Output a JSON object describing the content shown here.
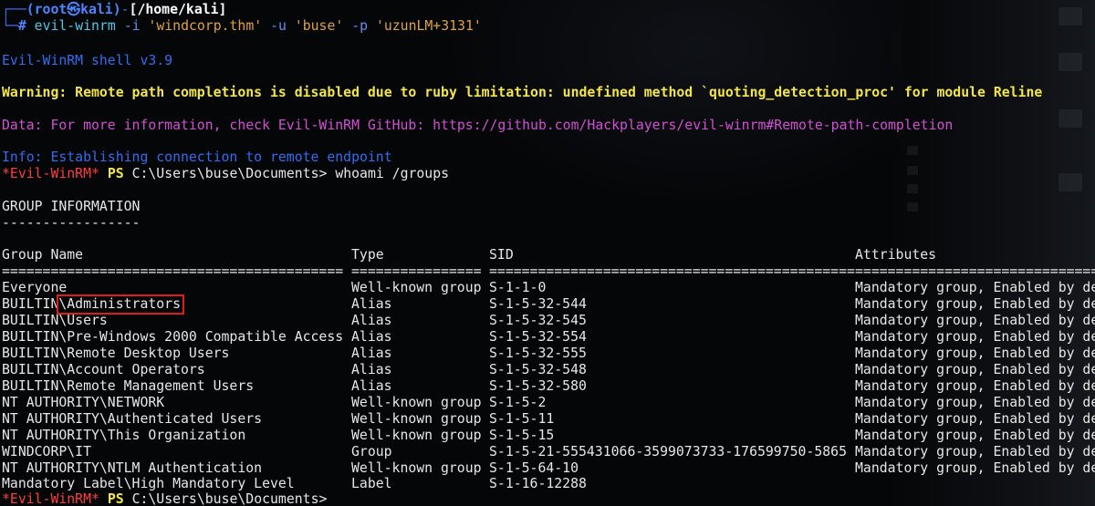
{
  "prompt": {
    "corner_top": "┌──",
    "user_host": "(root㉿kali)",
    "dash": "-",
    "path": "[/home/kali]",
    "corner_bottom": "└─",
    "hash": "#",
    "command_name": "evil-winrm",
    "flag_i": "-i",
    "arg_i": "'windcorp.thm'",
    "flag_u": "-u",
    "arg_u": "'buse'",
    "flag_p": "-p",
    "arg_p": "'uzunLM+3131'"
  },
  "output": {
    "version_line": "Evil-WinRM shell v3.9",
    "warning_line": "Warning: Remote path completions is disabled due to ruby limitation: undefined method `quoting_detection_proc' for module Reline",
    "data_line": "Data: For more information, check Evil-WinRM GitHub: https://github.com/Hackplayers/evil-winrm#Remote-path-completion",
    "info_line": "Info: Establishing connection to remote endpoint"
  },
  "shell_prompt": {
    "evil": "*Evil-WinRM*",
    "ps": "PS",
    "cwd": "C:\\Users\\buse\\Documents>",
    "command": "whoami /groups"
  },
  "group_info": {
    "title": "GROUP INFORMATION",
    "title_underline": "-----------------",
    "headers": {
      "name": "Group Name",
      "type": "Type",
      "sid": "SID",
      "attributes": "Attributes"
    },
    "separators": {
      "name": "==========================================",
      "type": "================",
      "sid": "=============================================",
      "attributes": "=============================="
    },
    "rows": [
      {
        "name": "Everyone",
        "type": "Well-known group",
        "sid": "S-1-1-0",
        "attributes": "Mandatory group, Enabled by de"
      },
      {
        "name": "BUILTIN\\Administrators",
        "type": "Alias",
        "sid": "S-1-5-32-544",
        "attributes": "Mandatory group, Enabled by de"
      },
      {
        "name": "BUILTIN\\Users",
        "type": "Alias",
        "sid": "S-1-5-32-545",
        "attributes": "Mandatory group, Enabled by de"
      },
      {
        "name": "BUILTIN\\Pre-Windows 2000 Compatible Access",
        "type": "Alias",
        "sid": "S-1-5-32-554",
        "attributes": "Mandatory group, Enabled by de"
      },
      {
        "name": "BUILTIN\\Remote Desktop Users",
        "type": "Alias",
        "sid": "S-1-5-32-555",
        "attributes": "Mandatory group, Enabled by de"
      },
      {
        "name": "BUILTIN\\Account Operators",
        "type": "Alias",
        "sid": "S-1-5-32-548",
        "attributes": "Mandatory group, Enabled by de"
      },
      {
        "name": "BUILTIN\\Remote Management Users",
        "type": "Alias",
        "sid": "S-1-5-32-580",
        "attributes": "Mandatory group, Enabled by de"
      },
      {
        "name": "NT AUTHORITY\\NETWORK",
        "type": "Well-known group",
        "sid": "S-1-5-2",
        "attributes": "Mandatory group, Enabled by de"
      },
      {
        "name": "NT AUTHORITY\\Authenticated Users",
        "type": "Well-known group",
        "sid": "S-1-5-11",
        "attributes": "Mandatory group, Enabled by de"
      },
      {
        "name": "NT AUTHORITY\\This Organization",
        "type": "Well-known group",
        "sid": "S-1-5-15",
        "attributes": "Mandatory group, Enabled by de"
      },
      {
        "name": "WINDCORP\\IT",
        "type": "Group",
        "sid": "S-1-5-21-555431066-3599073733-176599750-5865",
        "attributes": "Mandatory group, Enabled by de"
      },
      {
        "name": "NT AUTHORITY\\NTLM Authentication",
        "type": "Well-known group",
        "sid": "S-1-5-64-10",
        "attributes": "Mandatory group, Enabled by de"
      },
      {
        "name": "Mandatory Label\\High Mandatory Level",
        "type": "Label",
        "sid": "S-1-16-12288",
        "attributes": ""
      }
    ]
  },
  "final_prompt": {
    "evil": "*Evil-WinRM*",
    "ps": "PS",
    "cwd": "C:\\Users\\buse\\Documents>"
  },
  "colors": {
    "background": "#050608",
    "prompt_blue": "#3b6cf0",
    "warning_yellow": "#f2e54a",
    "data_magenta": "#d050d0",
    "info_blue": "#2f6df0",
    "evil_red": "#ff3c3c",
    "highlight_red": "#e11c1c"
  }
}
